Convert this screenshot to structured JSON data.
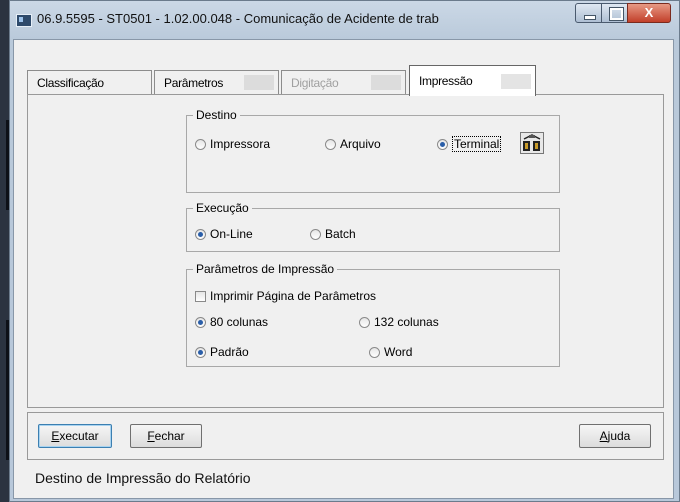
{
  "window": {
    "title": "06.9.5595 - ST0501 - 1.02.00.048 - Comunicação de Acidente de trab",
    "controls": {
      "minimize": "minimize",
      "maximize": "maximize",
      "close": "X"
    }
  },
  "tabs": [
    {
      "label": "Classificação",
      "state": "normal"
    },
    {
      "label": "Parâmetros",
      "state": "normal"
    },
    {
      "label": "Digitação",
      "state": "disabled"
    },
    {
      "label": "Impressão",
      "state": "active"
    }
  ],
  "destino": {
    "legend": "Destino",
    "options": [
      "Impressora",
      "Arquivo",
      "Terminal"
    ],
    "selected": "Terminal",
    "tool_icon": "printer-setup-icon"
  },
  "execucao": {
    "legend": "Execução",
    "options": [
      "On-Line",
      "Batch"
    ],
    "selected": "On-Line"
  },
  "parametros_impressao": {
    "legend": "Parâmetros de Impressão",
    "checkbox_label": "Imprimir Página de Parâmetros",
    "checkbox_checked": false,
    "columns_options": [
      "80 colunas",
      "132 colunas"
    ],
    "columns_selected": "80 colunas",
    "format_options": [
      "Padrão",
      "Word"
    ],
    "format_selected": "Padrão"
  },
  "buttons": {
    "executar_rest": "xecutar",
    "executar_mnemonic": "E",
    "fechar_mnemonic": "F",
    "fechar_rest": "echar",
    "ajuda_mnemonic": "A",
    "ajuda_rest": "juda"
  },
  "status_bar": "Destino de Impressão do Relatório",
  "colors": {
    "accent_radio": "#2a5ea8",
    "close_button": "#c2402a"
  }
}
